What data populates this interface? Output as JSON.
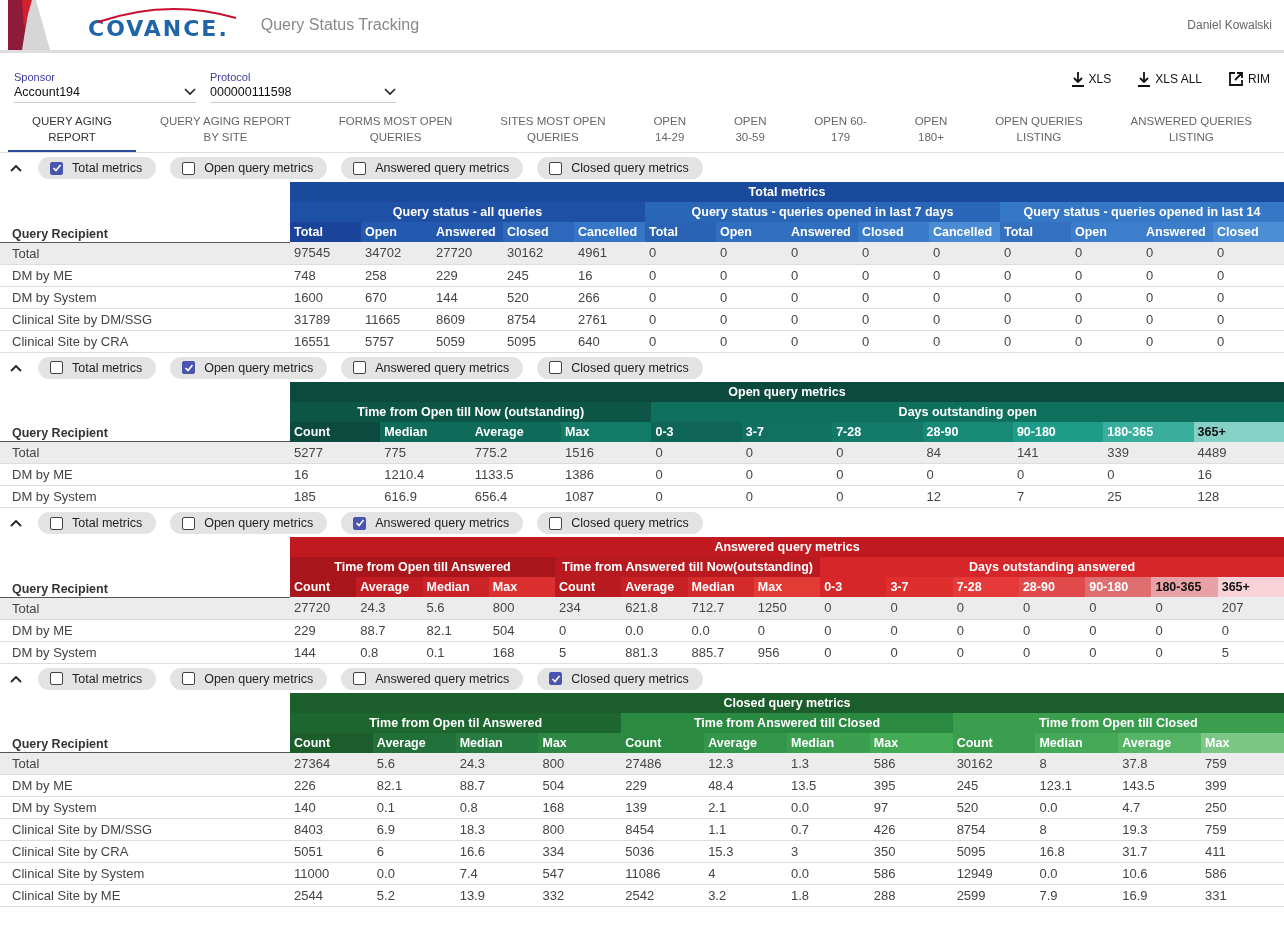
{
  "header": {
    "logo_text": "COVANCE.",
    "title": "Query Status Tracking",
    "user": "Daniel Kowalski"
  },
  "filters": [
    {
      "label": "Sponsor",
      "value": "Account194"
    },
    {
      "label": "Protocol",
      "value": "000000111598"
    }
  ],
  "exports": [
    {
      "label": "XLS",
      "kind": "download"
    },
    {
      "label": "XLS ALL",
      "kind": "download"
    },
    {
      "label": "RIM",
      "kind": "external"
    }
  ],
  "tabs": [
    {
      "label": "QUERY AGING\nREPORT",
      "selected": true
    },
    {
      "label": "QUERY AGING REPORT\nBY SITE",
      "selected": false
    },
    {
      "label": "FORMS MOST OPEN\nQUERIES",
      "selected": false
    },
    {
      "label": "SITES MOST OPEN\nQUERIES",
      "selected": false
    },
    {
      "label": "OPEN\n14-29",
      "selected": false
    },
    {
      "label": "OPEN\n30-59",
      "selected": false
    },
    {
      "label": "OPEN 60-\n179",
      "selected": false
    },
    {
      "label": "OPEN\n180+",
      "selected": false
    },
    {
      "label": "OPEN QUERIES\nLISTING",
      "selected": false
    },
    {
      "label": "ANSWERED QUERIES\nLISTING",
      "selected": false
    }
  ],
  "sections": [
    {
      "chips": [
        {
          "label": "Total metrics",
          "checked": true
        },
        {
          "label": "Open query metrics",
          "checked": false
        },
        {
          "label": "Answered query metrics",
          "checked": false
        },
        {
          "label": "Closed query metrics",
          "checked": false
        }
      ],
      "table": {
        "recipient_header": "Query Recipient",
        "title": {
          "label": "Total metrics",
          "color": "#1a4a9c"
        },
        "groups": [
          {
            "label": "Query status - all queries",
            "color": "#1e50a6",
            "columns": [
              {
                "label": "Total",
                "color": "#1a4499"
              },
              {
                "label": "Open",
                "color": "#2459b0"
              },
              {
                "label": "Answered",
                "color": "#2459b0"
              },
              {
                "label": "Closed",
                "color": "#2d68bd"
              },
              {
                "label": "Cancelled",
                "color": "#3676c6"
              }
            ]
          },
          {
            "label": "Query status - queries opened in last 7 days",
            "color": "#2a66b8",
            "columns": [
              {
                "label": "Total",
                "color": "#2a62b4"
              },
              {
                "label": "Open",
                "color": "#306ebf"
              },
              {
                "label": "Answered",
                "color": "#306ebf"
              },
              {
                "label": "Closed",
                "color": "#3a7cc9"
              },
              {
                "label": "Cancelled",
                "color": "#4a8cd3"
              }
            ]
          },
          {
            "label": "Query status - queries opened in last 14",
            "color": "#3478c6",
            "columns": [
              {
                "label": "Total",
                "color": "#3370c0"
              },
              {
                "label": "Open",
                "color": "#3c7ecb"
              },
              {
                "label": "Answered",
                "color": "#3c7ecb"
              },
              {
                "label": "Closed",
                "color": "#4a8dd4"
              }
            ]
          }
        ],
        "rows": [
          {
            "kind": "total",
            "cells": [
              "Total",
              "97545",
              "34702",
              "27720",
              "30162",
              "4961",
              "0",
              "0",
              "0",
              "0",
              "0",
              "0",
              "0",
              "0",
              "0"
            ]
          },
          {
            "kind": "item",
            "cells": [
              "DM by ME",
              "748",
              "258",
              "229",
              "245",
              "16",
              "0",
              "0",
              "0",
              "0",
              "0",
              "0",
              "0",
              "0",
              "0"
            ]
          },
          {
            "kind": "item",
            "cells": [
              "DM by System",
              "1600",
              "670",
              "144",
              "520",
              "266",
              "0",
              "0",
              "0",
              "0",
              "0",
              "0",
              "0",
              "0",
              "0"
            ]
          },
          {
            "kind": "item",
            "cells": [
              "Clinical Site by DM/SSG",
              "31789",
              "11665",
              "8609",
              "8754",
              "2761",
              "0",
              "0",
              "0",
              "0",
              "0",
              "0",
              "0",
              "0",
              "0"
            ]
          },
          {
            "kind": "item",
            "cells": [
              "Clinical Site by CRA",
              "16551",
              "5757",
              "5059",
              "5095",
              "640",
              "0",
              "0",
              "0",
              "0",
              "0",
              "0",
              "0",
              "0",
              "0"
            ]
          }
        ]
      }
    },
    {
      "chips": [
        {
          "label": "Total metrics",
          "checked": false
        },
        {
          "label": "Open query metrics",
          "checked": true
        },
        {
          "label": "Answered query metrics",
          "checked": false
        },
        {
          "label": "Closed query metrics",
          "checked": false
        }
      ],
      "table": {
        "recipient_header": "Query Recipient",
        "title": {
          "label": "Open query metrics",
          "color": "#0b4a3c"
        },
        "groups": [
          {
            "label": "Time from Open till Now (outstanding)",
            "color": "#0d5545",
            "columns": [
              {
                "label": "Count",
                "color": "#0b4a3c"
              },
              {
                "label": "Median",
                "color": "#0f6b59"
              },
              {
                "label": "Average",
                "color": "#0f6b59"
              },
              {
                "label": "Max",
                "color": "#127a66"
              }
            ]
          },
          {
            "label": "Days outstanding open",
            "color": "#10705e",
            "columns": [
              {
                "label": "0-3",
                "color": "#0f6656"
              },
              {
                "label": "3-7",
                "color": "#117060"
              },
              {
                "label": "7-28",
                "color": "#137a69"
              },
              {
                "label": "28-90",
                "color": "#178a77"
              },
              {
                "label": "90-180",
                "color": "#1f9c89"
              },
              {
                "label": "180-365",
                "color": "#3aae9c"
              },
              {
                "label": "365+",
                "color": "#86d1c5"
              }
            ]
          }
        ],
        "rows": [
          {
            "kind": "total",
            "cells": [
              "Total",
              "5277",
              "775",
              "775.2",
              "1516",
              "0",
              "0",
              "0",
              "84",
              "141",
              "339",
              "4489"
            ]
          },
          {
            "kind": "item",
            "cells": [
              "DM by ME",
              "16",
              "1210.4",
              "1133.5",
              "1386",
              "0",
              "0",
              "0",
              "0",
              "0",
              "0",
              "16"
            ]
          },
          {
            "kind": "item",
            "cells": [
              "DM by System",
              "185",
              "616.9",
              "656.4",
              "1087",
              "0",
              "0",
              "0",
              "12",
              "7",
              "25",
              "128"
            ]
          }
        ]
      }
    },
    {
      "chips": [
        {
          "label": "Total metrics",
          "checked": false
        },
        {
          "label": "Open query metrics",
          "checked": false
        },
        {
          "label": "Answered query metrics",
          "checked": true
        },
        {
          "label": "Closed query metrics",
          "checked": false
        }
      ],
      "table": {
        "recipient_header": "Query Recipient",
        "title": {
          "label": "Answered query metrics",
          "color": "#c01a20"
        },
        "groups": [
          {
            "label": "Time from Open till Answered",
            "color": "#a8161b",
            "columns": [
              {
                "label": "Count",
                "color": "#a8161b"
              },
              {
                "label": "Average",
                "color": "#c01c22"
              },
              {
                "label": "Median",
                "color": "#cc2328"
              },
              {
                "label": "Max",
                "color": "#dc3030"
              }
            ]
          },
          {
            "label": "Time from Answered till Now(outstanding)",
            "color": "#b81a20",
            "columns": [
              {
                "label": "Count",
                "color": "#b81a20"
              },
              {
                "label": "Average",
                "color": "#c82024"
              },
              {
                "label": "Median",
                "color": "#d42a2c"
              },
              {
                "label": "Max",
                "color": "#e23a35"
              }
            ]
          },
          {
            "label": "Days outstanding answered",
            "color": "#d6262a",
            "columns": [
              {
                "label": "0-3",
                "color": "#d6262a"
              },
              {
                "label": "3-7",
                "color": "#de2e2e"
              },
              {
                "label": "7-28",
                "color": "#e63a3a"
              },
              {
                "label": "28-90",
                "color": "#e04a4a"
              },
              {
                "label": "90-180",
                "color": "#de6e70"
              },
              {
                "label": "180-365",
                "color": "#e8a2a6"
              },
              {
                "label": "365+",
                "color": "#f8d2d8"
              }
            ]
          }
        ],
        "rows": [
          {
            "kind": "total",
            "cells": [
              "Total",
              "27720",
              "24.3",
              "5.6",
              "800",
              "234",
              "621.8",
              "712.7",
              "1250",
              "0",
              "0",
              "0",
              "0",
              "0",
              "0",
              "207"
            ]
          },
          {
            "kind": "item",
            "cells": [
              "DM by ME",
              "229",
              "88.7",
              "82.1",
              "504",
              "0",
              "0.0",
              "0.0",
              "0",
              "0",
              "0",
              "0",
              "0",
              "0",
              "0",
              "0"
            ]
          },
          {
            "kind": "item",
            "cells": [
              "DM by System",
              "144",
              "0.8",
              "0.1",
              "168",
              "5",
              "881.3",
              "885.7",
              "956",
              "0",
              "0",
              "0",
              "0",
              "0",
              "0",
              "5"
            ]
          }
        ]
      }
    },
    {
      "chips": [
        {
          "label": "Total metrics",
          "checked": false
        },
        {
          "label": "Open query metrics",
          "checked": false
        },
        {
          "label": "Answered query metrics",
          "checked": false
        },
        {
          "label": "Closed query metrics",
          "checked": true
        }
      ],
      "table": {
        "recipient_header": "Query Recipient",
        "title": {
          "label": "Closed query metrics",
          "color": "#1b5e2c"
        },
        "groups": [
          {
            "label": "Time from Open til Answered",
            "color": "#1d6630",
            "columns": [
              {
                "label": "Count",
                "color": "#1b5e2c"
              },
              {
                "label": "Average",
                "color": "#21703a"
              },
              {
                "label": "Median",
                "color": "#267c40"
              },
              {
                "label": "Max",
                "color": "#2c8844"
              }
            ]
          },
          {
            "label": "Time from Answered till Closed",
            "color": "#2b8a42",
            "columns": [
              {
                "label": "Count",
                "color": "#2a8a42"
              },
              {
                "label": "Average",
                "color": "#33964a"
              },
              {
                "label": "Median",
                "color": "#3aa050"
              },
              {
                "label": "Max",
                "color": "#43aa56"
              }
            ]
          },
          {
            "label": "Time from Open till Closed",
            "color": "#3a9e4e",
            "columns": [
              {
                "label": "Count",
                "color": "#3a9e4e"
              },
              {
                "label": "Median",
                "color": "#45aa58"
              },
              {
                "label": "Average",
                "color": "#55b466"
              },
              {
                "label": "Max",
                "color": "#7cc686"
              }
            ]
          }
        ],
        "rows": [
          {
            "kind": "total",
            "cells": [
              "Total",
              "27364",
              "5.6",
              "24.3",
              "800",
              "27486",
              "12.3",
              "1.3",
              "586",
              "30162",
              "8",
              "37.8",
              "759"
            ]
          },
          {
            "kind": "item",
            "cells": [
              "DM by ME",
              "226",
              "82.1",
              "88.7",
              "504",
              "229",
              "48.4",
              "13.5",
              "395",
              "245",
              "123.1",
              "143.5",
              "399"
            ]
          },
          {
            "kind": "item",
            "cells": [
              "DM by System",
              "140",
              "0.1",
              "0.8",
              "168",
              "139",
              "2.1",
              "0.0",
              "97",
              "520",
              "0.0",
              "4.7",
              "250"
            ]
          },
          {
            "kind": "item",
            "cells": [
              "Clinical Site by DM/SSG",
              "8403",
              "6.9",
              "18.3",
              "800",
              "8454",
              "1.1",
              "0.7",
              "426",
              "8754",
              "8",
              "19.3",
              "759"
            ]
          },
          {
            "kind": "item",
            "cells": [
              "Clinical Site by CRA",
              "5051",
              "6",
              "16.6",
              "334",
              "5036",
              "15.3",
              "3",
              "350",
              "5095",
              "16.8",
              "31.7",
              "411"
            ]
          },
          {
            "kind": "item",
            "cells": [
              "Clinical Site by System",
              "11000",
              "0.0",
              "7.4",
              "547",
              "11086",
              "4",
              "0.0",
              "586",
              "12949",
              "0.0",
              "10.6",
              "586"
            ]
          },
          {
            "kind": "item",
            "cells": [
              "Clinical Site by ME",
              "2544",
              "5.2",
              "13.9",
              "332",
              "2542",
              "3.2",
              "1.8",
              "288",
              "2599",
              "7.9",
              "16.9",
              "331"
            ]
          }
        ]
      }
    }
  ]
}
